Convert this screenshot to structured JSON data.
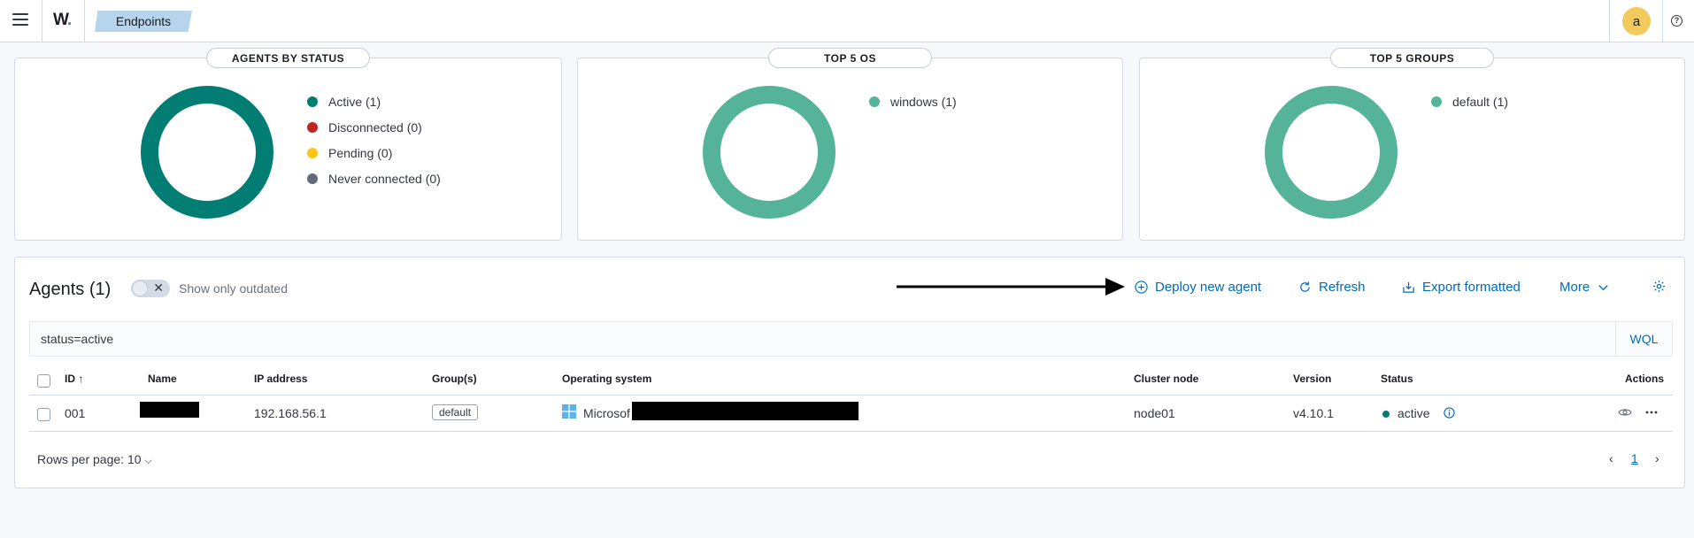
{
  "header": {
    "logo_text": "W",
    "breadcrumb": "Endpoints",
    "avatar_initial": "a",
    "help_icon": "?"
  },
  "cards": [
    {
      "title": "AGENTS BY STATUS",
      "donut_color": "#017d73",
      "legend": [
        {
          "label": "Active (1)",
          "color": "#017d73"
        },
        {
          "label": "Disconnected (0)",
          "color": "#bd271e"
        },
        {
          "label": "Pending (0)",
          "color": "#fec514"
        },
        {
          "label": "Never connected (0)",
          "color": "#646a77"
        }
      ]
    },
    {
      "title": "TOP 5 OS",
      "donut_color": "#54b399",
      "legend": [
        {
          "label": "windows (1)",
          "color": "#54b399"
        }
      ]
    },
    {
      "title": "TOP 5 GROUPS",
      "donut_color": "#54b399",
      "legend": [
        {
          "label": "default (1)",
          "color": "#54b399"
        }
      ]
    }
  ],
  "agents": {
    "title": "Agents (1)",
    "toggle_label": "Show only outdated",
    "actions": {
      "deploy": "Deploy new agent",
      "refresh": "Refresh",
      "export": "Export formatted",
      "more": "More"
    },
    "search": {
      "value": "status=active",
      "wql": "WQL"
    },
    "columns": {
      "id": "ID",
      "name": "Name",
      "ip": "IP address",
      "groups": "Group(s)",
      "os": "Operating system",
      "cluster": "Cluster node",
      "version": "Version",
      "status": "Status",
      "actions": "Actions"
    },
    "rows": [
      {
        "id": "001",
        "ip": "192.168.56.1",
        "group": "default",
        "os": "Microsof",
        "cluster": "node01",
        "version": "v4.10.1",
        "status": "active",
        "status_color": "#017d73"
      }
    ],
    "rows_per_page": "Rows per page: 10",
    "current_page": "1"
  }
}
